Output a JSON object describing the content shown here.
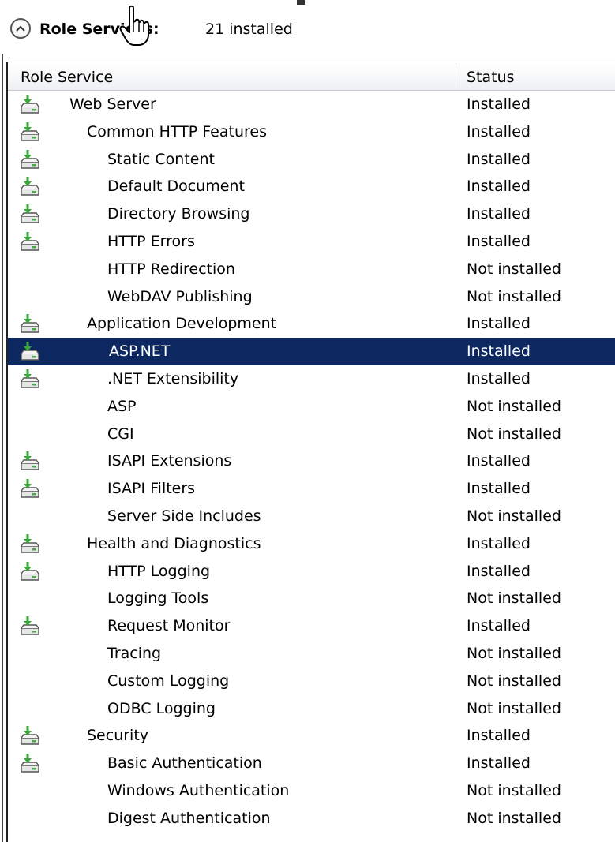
{
  "section": {
    "title": "Role Services:",
    "count": "21 installed"
  },
  "columns": {
    "role_service": "Role Service",
    "status": "Status"
  },
  "icons": {
    "collapse": "chevron-up-icon",
    "cursor": "hand-pointer-icon",
    "installed": "installed-drive-icon"
  },
  "colors": {
    "selected_bg": "#0d2860",
    "installed_arrow": "#3aa73a"
  },
  "rows": [
    {
      "name": "Web Server",
      "status": "Installed",
      "level": 0,
      "icon": true
    },
    {
      "name": "Common HTTP Features",
      "status": "Installed",
      "level": 1,
      "icon": true
    },
    {
      "name": "Static Content",
      "status": "Installed",
      "level": 2,
      "icon": true
    },
    {
      "name": "Default Document",
      "status": "Installed",
      "level": 2,
      "icon": true
    },
    {
      "name": "Directory Browsing",
      "status": "Installed",
      "level": 2,
      "icon": true
    },
    {
      "name": "HTTP Errors",
      "status": "Installed",
      "level": 2,
      "icon": true
    },
    {
      "name": "HTTP Redirection",
      "status": "Not installed",
      "level": 2,
      "icon": false
    },
    {
      "name": "WebDAV Publishing",
      "status": "Not installed",
      "level": 2,
      "icon": false
    },
    {
      "name": "Application Development",
      "status": "Installed",
      "level": 1,
      "icon": true
    },
    {
      "name": "ASP.NET",
      "status": "Installed",
      "level": 2,
      "icon": true,
      "selected": true
    },
    {
      "name": ".NET Extensibility",
      "status": "Installed",
      "level": 2,
      "icon": true
    },
    {
      "name": "ASP",
      "status": "Not installed",
      "level": 2,
      "icon": false
    },
    {
      "name": "CGI",
      "status": "Not installed",
      "level": 2,
      "icon": false
    },
    {
      "name": "ISAPI Extensions",
      "status": "Installed",
      "level": 2,
      "icon": true
    },
    {
      "name": "ISAPI Filters",
      "status": "Installed",
      "level": 2,
      "icon": true
    },
    {
      "name": "Server Side Includes",
      "status": "Not installed",
      "level": 2,
      "icon": false
    },
    {
      "name": "Health and Diagnostics",
      "status": "Installed",
      "level": 1,
      "icon": true
    },
    {
      "name": "HTTP Logging",
      "status": "Installed",
      "level": 2,
      "icon": true
    },
    {
      "name": "Logging Tools",
      "status": "Not installed",
      "level": 2,
      "icon": false
    },
    {
      "name": "Request Monitor",
      "status": "Installed",
      "level": 2,
      "icon": true
    },
    {
      "name": "Tracing",
      "status": "Not installed",
      "level": 2,
      "icon": false
    },
    {
      "name": "Custom Logging",
      "status": "Not installed",
      "level": 2,
      "icon": false
    },
    {
      "name": "ODBC Logging",
      "status": "Not installed",
      "level": 2,
      "icon": false
    },
    {
      "name": "Security",
      "status": "Installed",
      "level": 1,
      "icon": true
    },
    {
      "name": "Basic Authentication",
      "status": "Installed",
      "level": 2,
      "icon": true
    },
    {
      "name": "Windows Authentication",
      "status": "Not installed",
      "level": 2,
      "icon": false
    },
    {
      "name": "Digest Authentication",
      "status": "Not installed",
      "level": 2,
      "icon": false
    }
  ]
}
